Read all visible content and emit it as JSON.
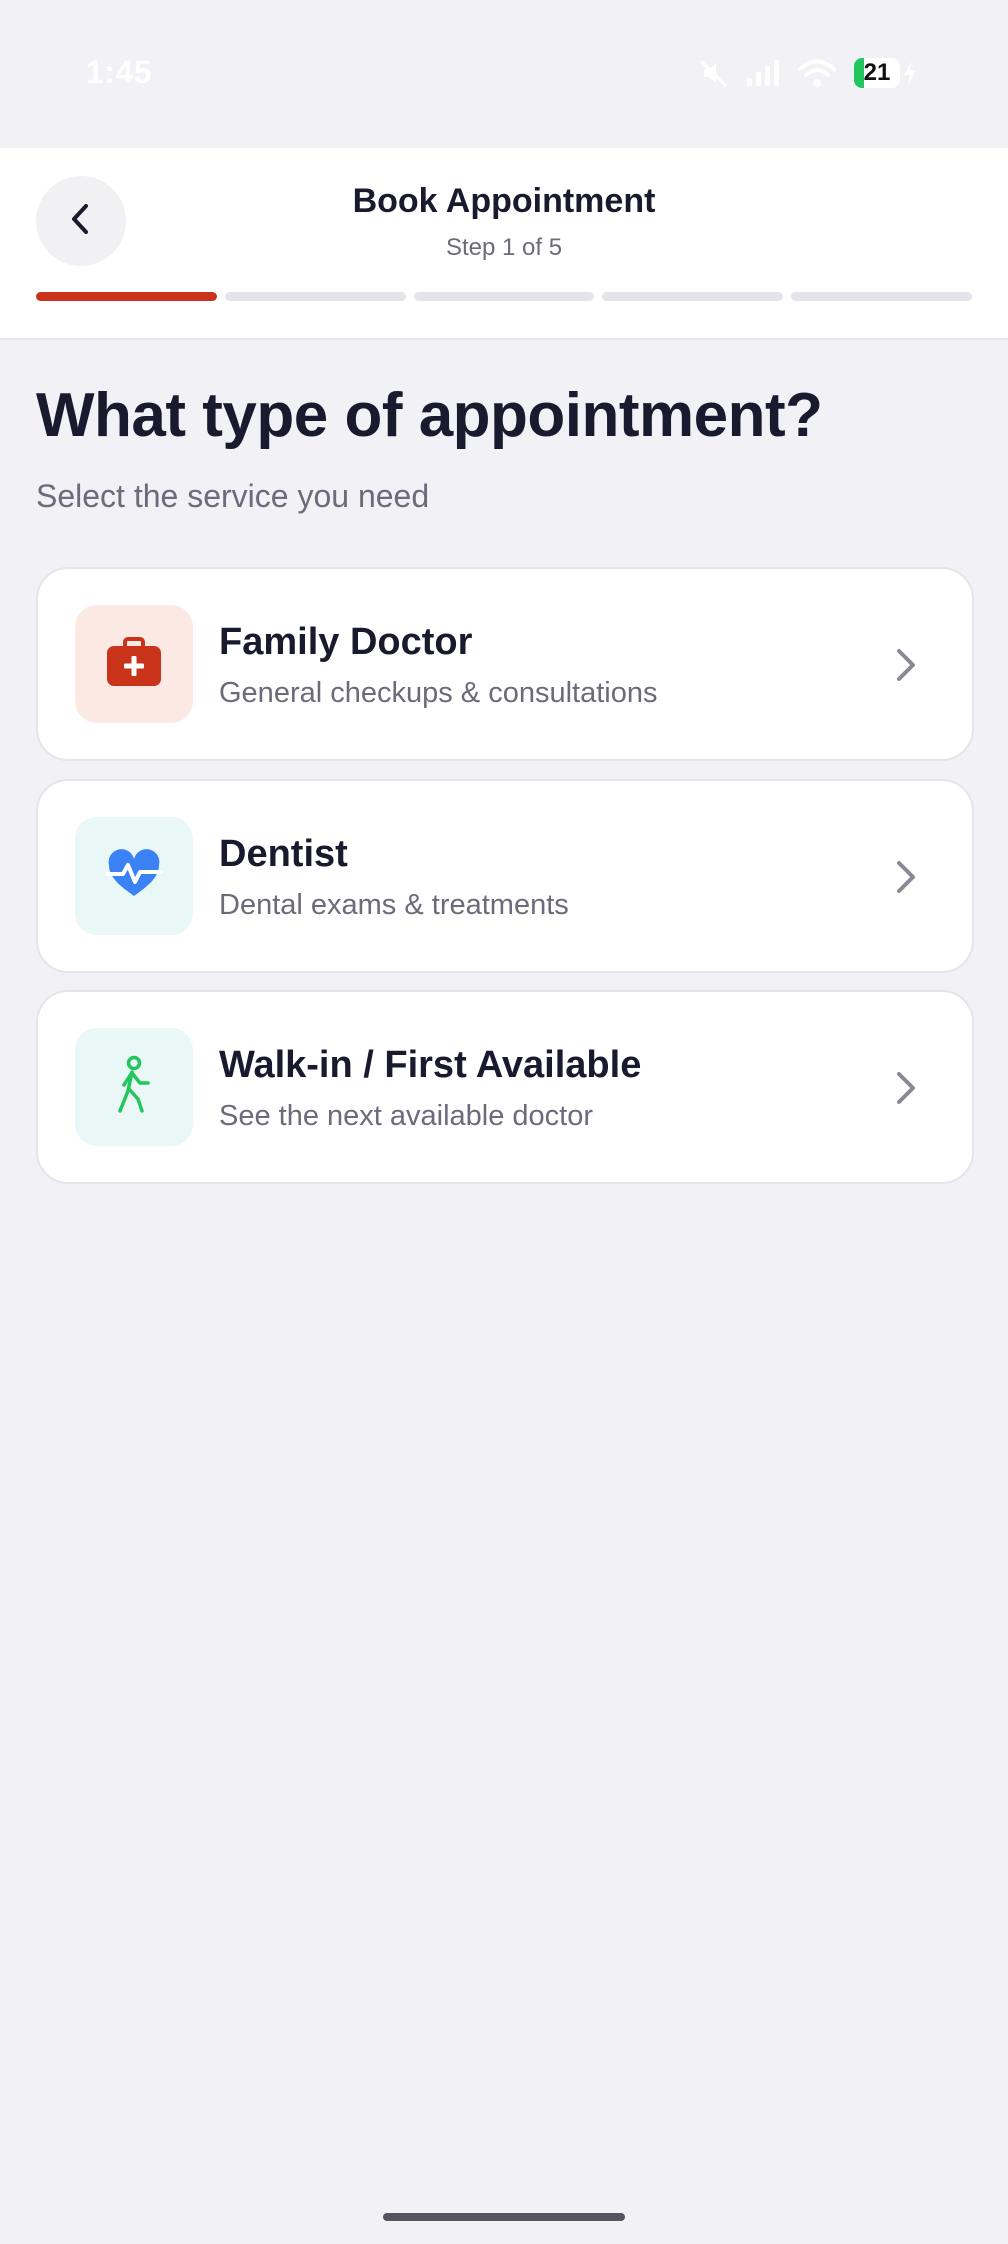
{
  "status_bar": {
    "time": "1:45",
    "battery_level": "21",
    "battery_fill_percent": 21,
    "battery_color": "#22c55e"
  },
  "header": {
    "title": "Book Appointment",
    "step": "Step 1 of 5",
    "progress_total_steps": 5,
    "progress_current_step": 1,
    "progress_active_color": "#c9331a",
    "progress_inactive_color": "#e4e4ea"
  },
  "main": {
    "heading": "What type of appointment?",
    "subheading": "Select the service you need",
    "services": [
      {
        "title": "Family Doctor",
        "description": "General checkups & consultations",
        "icon": "medical-kit-icon",
        "icon_color": "#c9331a",
        "icon_bg": "#fde9e4"
      },
      {
        "title": "Dentist",
        "description": "Dental exams & treatments",
        "icon": "heart-pulse-icon",
        "icon_color": "#3b82f6",
        "icon_bg": "#eaf7f7"
      },
      {
        "title": "Walk-in / First Available",
        "description": "See the next available doctor",
        "icon": "walking-person-icon",
        "icon_color": "#22c55e",
        "icon_bg": "#eaf7f7"
      }
    ]
  }
}
